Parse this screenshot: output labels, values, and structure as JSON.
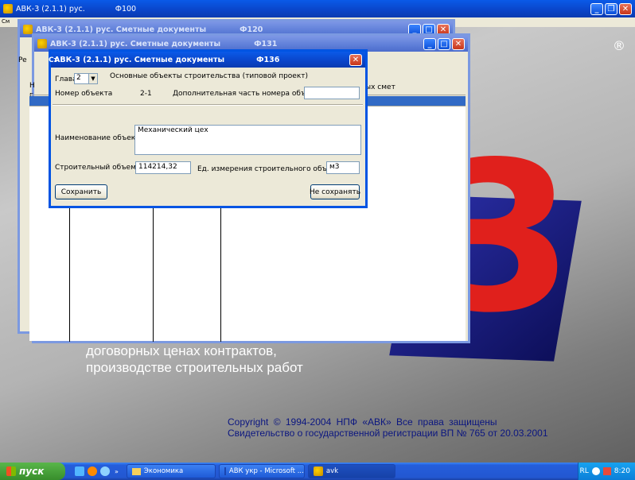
{
  "desktop": {
    "splash_line1": "договорных ценах контрактов,",
    "splash_line2": "производстве строительных работ",
    "copyright1": "Copyright © 1994-2004 НПФ «АВК» Все права защищены",
    "copyright2": "Свидетельство о государственной регистрации ВП № 765 от 20.03.2001",
    "logo_letter": "3",
    "reg_mark": "®"
  },
  "main_window": {
    "title": "АВК-3 (2.1.1)  рус.",
    "code": "Ф100",
    "menu_left": "Cм"
  },
  "win120": {
    "title": "АВК-3 (2.1.1)  рус.   Сметные документы",
    "code": "Ф120"
  },
  "win131": {
    "title": "АВК-3 (2.1.1)  рус.   Сметные документы",
    "code": "Ф131",
    "left_text": "Pe",
    "row_h": "Н",
    "row_g": "г",
    "col_header": "ых смет"
  },
  "dialog": {
    "title": "АВК-3 (2.1.1)  рус.   Сметные документы",
    "code": "Ф136",
    "left_text": "Ст",
    "chapter_label": "Глава",
    "chapter_value": "2",
    "chapter_name": "Основные объекты строительства (типовой проект)",
    "object_no_label": "Номер объекта",
    "object_no_value": "2-1",
    "extra_label": "Дополнительная часть номера объекта",
    "extra_value": "",
    "name_label": "Наименование объекта",
    "name_value": "Механический цех",
    "volume_label": "Строительный объем",
    "volume_value": "114214,32",
    "unit_label": "Ед. измерения строительного объема",
    "unit_value": "м3",
    "save_label": "Сохранить",
    "nosave_label": "Не сохранять"
  },
  "taskbar": {
    "start_label": "пуск",
    "items": [
      "Экономика",
      "АВК укр - Microsoft ...",
      "avk"
    ],
    "lang": "RL",
    "time": "8:20"
  }
}
